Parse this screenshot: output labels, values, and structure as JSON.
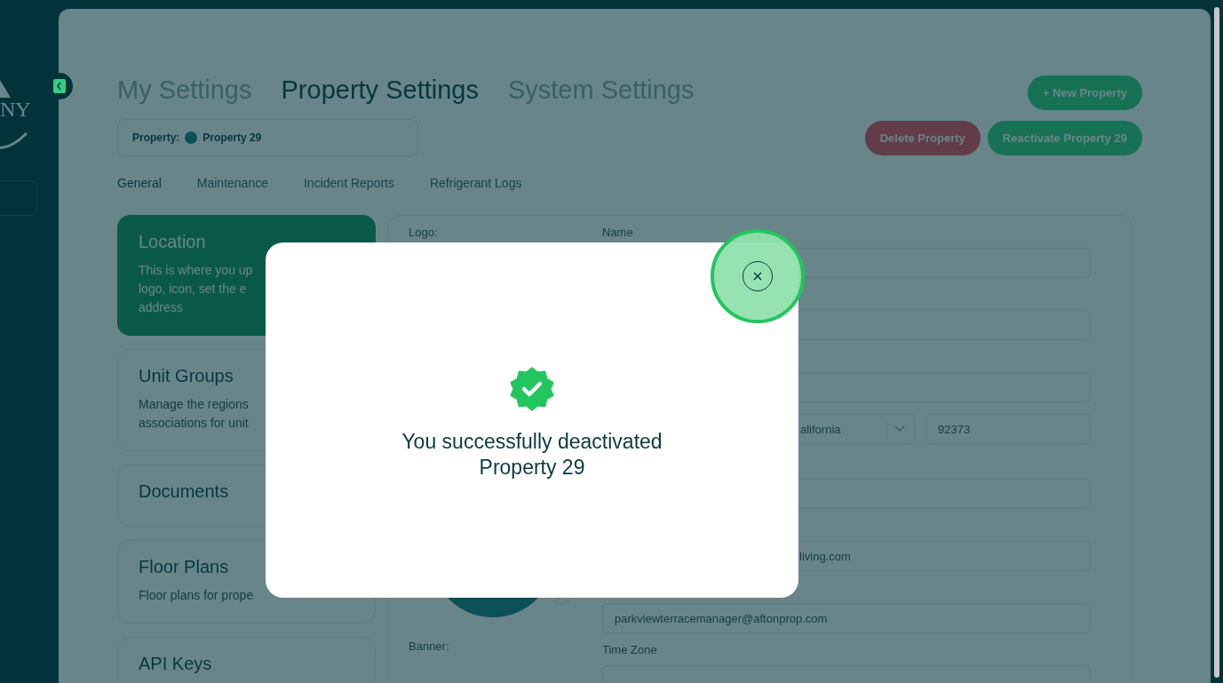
{
  "sidebar": {
    "logo_text": "NY"
  },
  "header": {
    "tabs": [
      {
        "label": "My Settings",
        "selected": false
      },
      {
        "label": "Property Settings",
        "selected": true
      },
      {
        "label": "System Settings",
        "selected": false
      }
    ],
    "property_selector": {
      "label": "Property:",
      "value": "Property 29"
    },
    "buttons": [
      {
        "label": "+ New Property",
        "kind": "primary"
      },
      {
        "label": "Delete Property",
        "kind": "danger"
      },
      {
        "label": "Reactivate Property 29",
        "kind": "primary"
      }
    ]
  },
  "subtabs": [
    {
      "label": "General",
      "selected": true
    },
    {
      "label": "Maintenance",
      "selected": false
    },
    {
      "label": "Incident Reports",
      "selected": false
    },
    {
      "label": "Refrigerant Logs",
      "selected": false
    }
  ],
  "sections": [
    {
      "title": "Location",
      "description": [
        "This is where you up",
        "logo, icon, set the e",
        "address"
      ],
      "selected": true
    },
    {
      "title": "Unit Groups",
      "description": [
        "Manage the regions",
        "associations for unit"
      ],
      "selected": false
    },
    {
      "title": "Documents",
      "selected": false
    },
    {
      "title": "Floor Plans",
      "description": [
        "Floor plans for prope"
      ],
      "selected": false
    },
    {
      "title": "API Keys",
      "selected": false
    }
  ],
  "form": {
    "logo_label": "Logo:",
    "banner_label": "Banner:",
    "fields": [
      {
        "kind": "text",
        "label": "Name"
      },
      {
        "kind": "text"
      },
      {
        "kind": "text"
      },
      {
        "kind": "address",
        "state": "alifornia",
        "zip": "92373"
      },
      {
        "kind": "text"
      },
      {
        "kind": "text",
        "value": "living.com",
        "covered": true
      },
      {
        "kind": "text",
        "value": "parkviewterracemanager@aftonprop.com"
      },
      {
        "kind": "text",
        "label": "Time Zone"
      }
    ]
  },
  "modal": {
    "message": "You successfully deactivated Property 29"
  }
}
